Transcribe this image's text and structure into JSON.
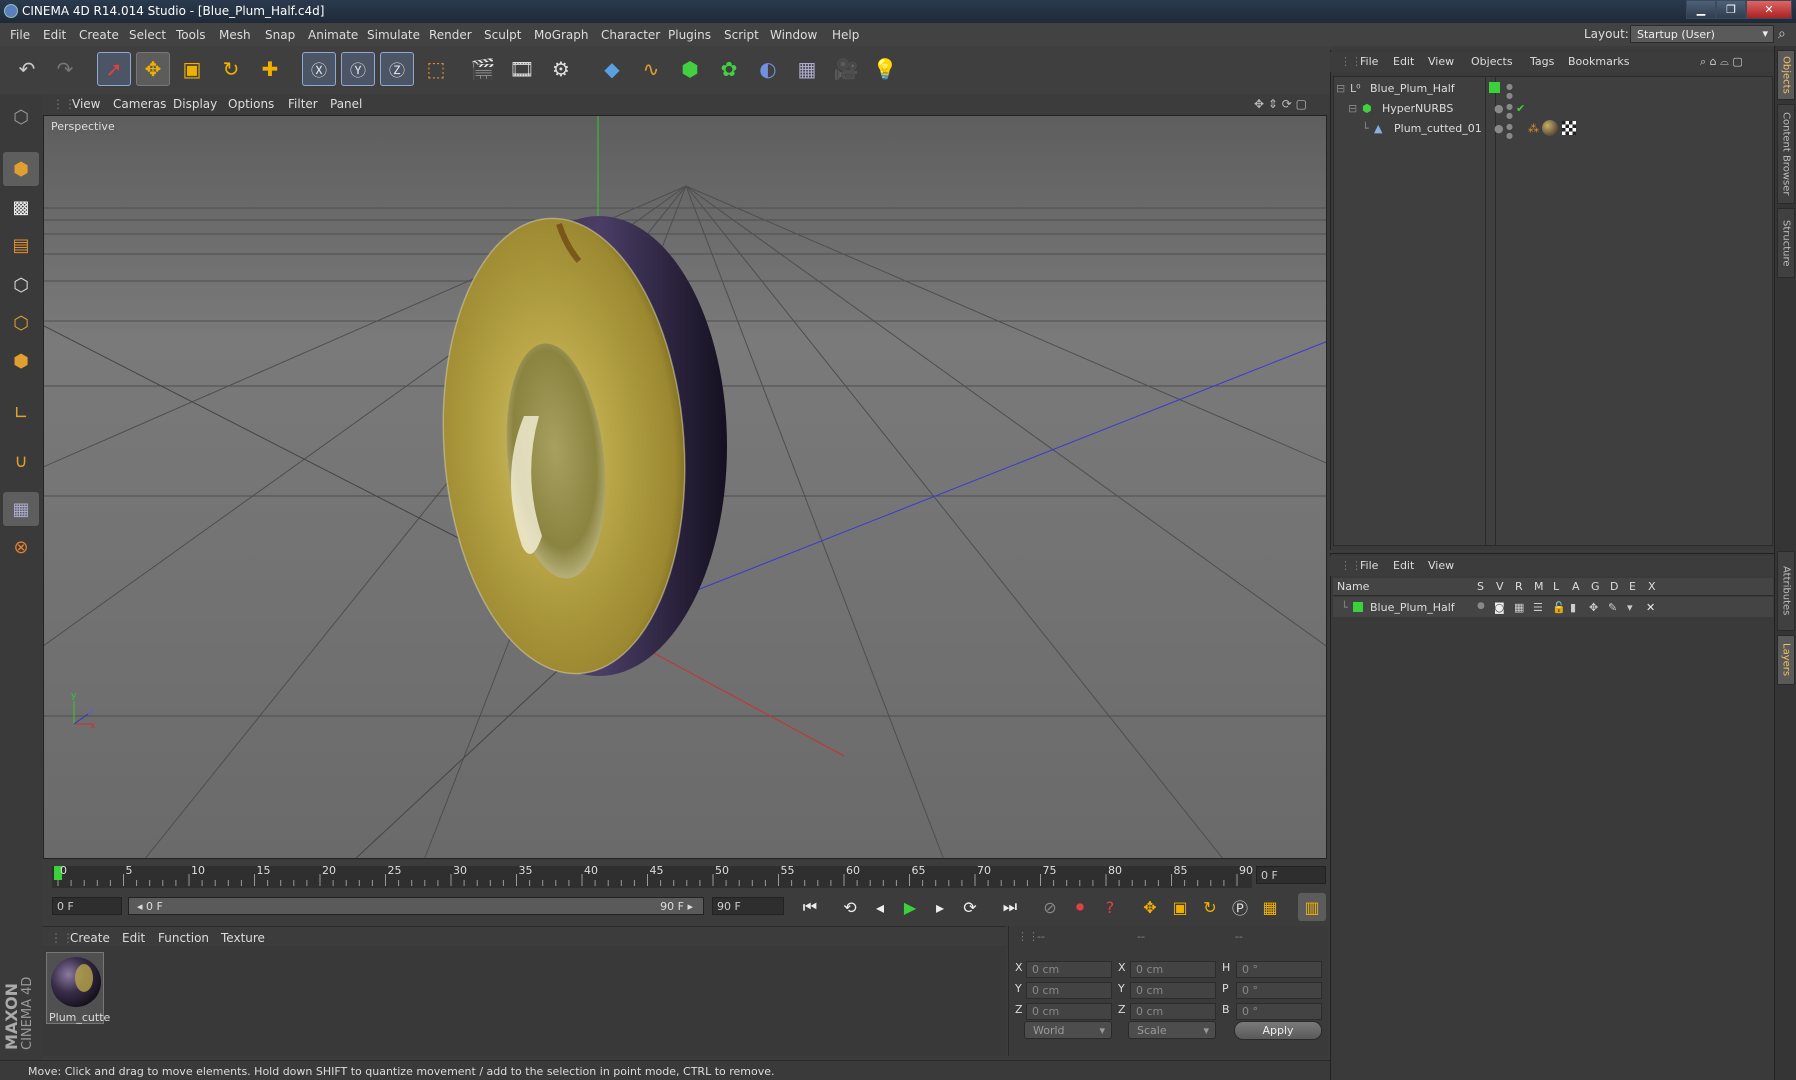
{
  "window": {
    "title": "CINEMA 4D R14.014 Studio - [Blue_Plum_Half.c4d]"
  },
  "menu": [
    "File",
    "Edit",
    "Create",
    "Select",
    "Tools",
    "Mesh",
    "Snap",
    "Animate",
    "Simulate",
    "Render",
    "Sculpt",
    "MoGraph",
    "Character",
    "Plugins",
    "Script",
    "Window",
    "Help"
  ],
  "layout": {
    "label": "Layout:",
    "value": "Startup (User)"
  },
  "viewport": {
    "menu": [
      "View",
      "Cameras",
      "Display",
      "Options",
      "Filter",
      "Panel"
    ],
    "label": "Perspective"
  },
  "timeline": {
    "ticks": [
      "0",
      "5",
      "10",
      "15",
      "20",
      "25",
      "30",
      "35",
      "40",
      "45",
      "50",
      "55",
      "60",
      "65",
      "70",
      "75",
      "80",
      "85",
      "90"
    ],
    "current_frame": "0 F",
    "start": "0 F",
    "slider_left": "◂ 0 F",
    "slider_right": "90 F ▸",
    "end": "90 F"
  },
  "material_editor": {
    "menu": [
      "Create",
      "Edit",
      "Function",
      "Texture"
    ],
    "material_name": "Plum_cutte"
  },
  "coordinates": {
    "header": [
      "--",
      "--",
      "--"
    ],
    "rows": [
      {
        "l1": "X",
        "v1": "0 cm",
        "l2": "X",
        "v2": "0 cm",
        "l3": "H",
        "v3": "0 °"
      },
      {
        "l1": "Y",
        "v1": "0 cm",
        "l2": "Y",
        "v2": "0 cm",
        "l3": "P",
        "v3": "0 °"
      },
      {
        "l1": "Z",
        "v1": "0 cm",
        "l2": "Z",
        "v2": "0 cm",
        "l3": "B",
        "v3": "0 °"
      }
    ],
    "world": "World",
    "scale": "Scale",
    "apply": "Apply"
  },
  "status": "Move: Click and drag to move elements. Hold down SHIFT to quantize movement / add to the selection in point mode, CTRL to remove.",
  "objects": {
    "menu": [
      "File",
      "Edit",
      "View",
      "Objects",
      "Tags",
      "Bookmarks"
    ],
    "items": [
      {
        "name": "Blue_Plum_Half"
      },
      {
        "name": "HyperNURBS"
      },
      {
        "name": "Plum_cutted_01"
      }
    ]
  },
  "layers": {
    "menu": [
      "File",
      "Edit",
      "View"
    ],
    "columns": [
      "Name",
      "S",
      "V",
      "R",
      "M",
      "L",
      "A",
      "G",
      "D",
      "E",
      "X"
    ],
    "items": [
      {
        "name": "Blue_Plum_Half"
      }
    ]
  },
  "side_tabs": [
    "Objects",
    "Content Browser",
    "Structure",
    "Attributes",
    "Layers"
  ],
  "brand": {
    "maxon": "MAXON",
    "product": "CINEMA 4D"
  },
  "colors": {
    "layer_green": "#3bd13b",
    "accent_blue": "#8fa8d0",
    "axis_x": "#c83232",
    "axis_y": "#32c832",
    "axis_z": "#3232c8"
  }
}
